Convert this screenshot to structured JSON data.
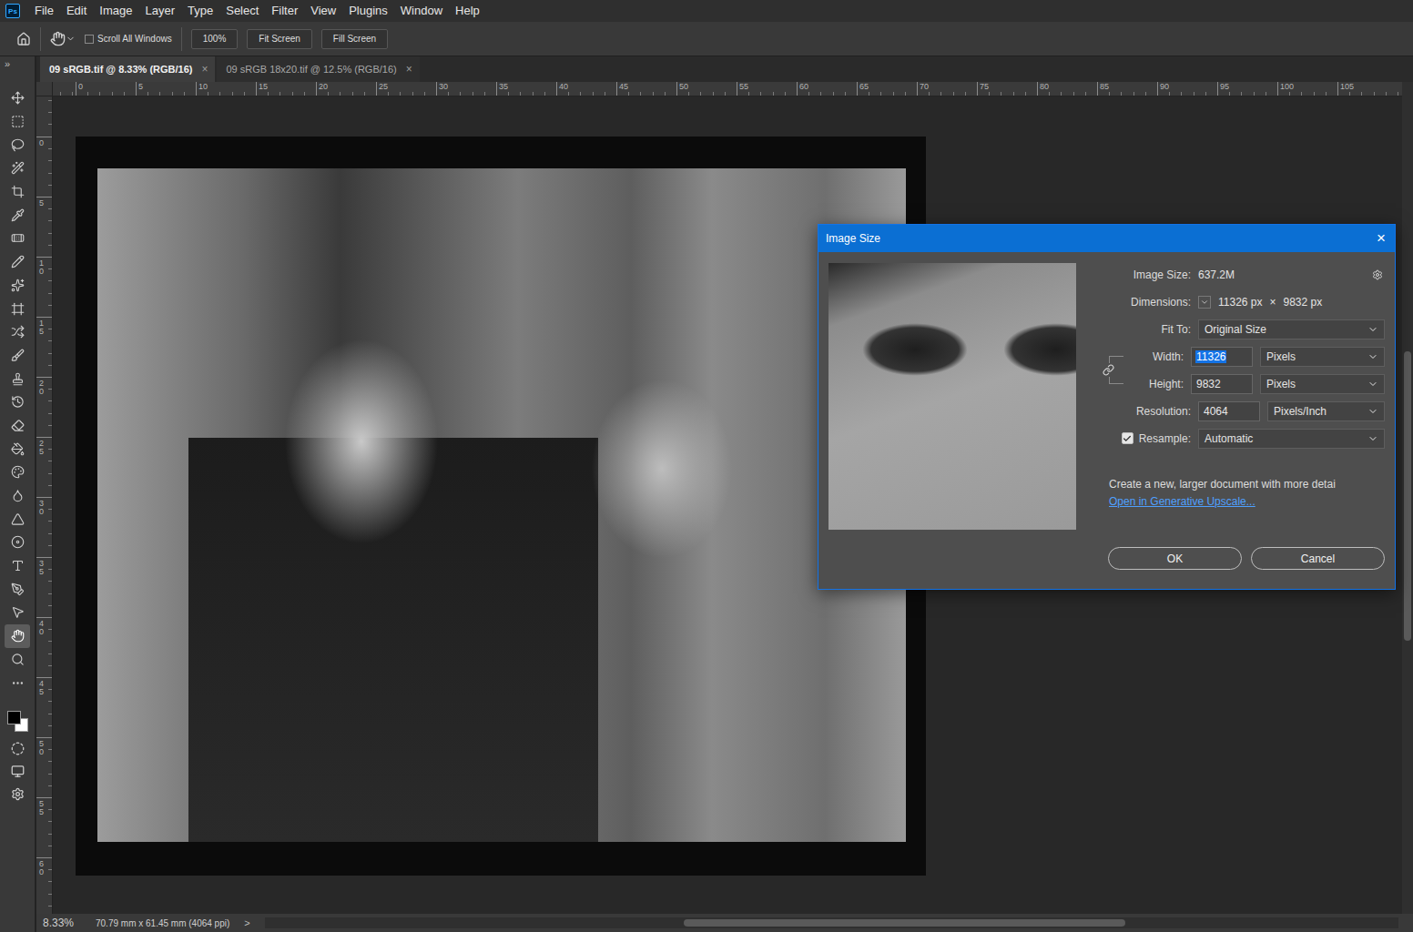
{
  "app": {
    "logo": "Ps"
  },
  "menu": [
    "File",
    "Edit",
    "Image",
    "Layer",
    "Type",
    "Select",
    "Filter",
    "View",
    "Plugins",
    "Window",
    "Help"
  ],
  "options_bar": {
    "scroll_all_windows": {
      "label": "Scroll All Windows",
      "checked": false
    },
    "buttons": [
      "100%",
      "Fit Screen",
      "Fill Screen"
    ]
  },
  "toolbar": {
    "collapse": "»",
    "tools": [
      {
        "kind": "move",
        "selected": false
      },
      {
        "kind": "marquee",
        "selected": false
      },
      {
        "kind": "lasso",
        "selected": false
      },
      {
        "kind": "wand",
        "selected": false
      },
      {
        "kind": "crop",
        "selected": false
      },
      {
        "kind": "eyedropper",
        "selected": false
      },
      {
        "kind": "healing",
        "selected": false
      },
      {
        "kind": "patch",
        "selected": false
      },
      {
        "kind": "spot",
        "selected": false
      },
      {
        "kind": "frame",
        "selected": false
      },
      {
        "kind": "content-move",
        "selected": false
      },
      {
        "kind": "brush",
        "selected": false
      },
      {
        "kind": "stamp",
        "selected": false
      },
      {
        "kind": "history-brush",
        "selected": false
      },
      {
        "kind": "eraser",
        "selected": false
      },
      {
        "kind": "fill",
        "selected": false
      },
      {
        "kind": "gradient",
        "selected": false
      },
      {
        "kind": "blur",
        "selected": false
      },
      {
        "kind": "sharpen",
        "selected": false
      },
      {
        "kind": "dodge",
        "selected": false
      },
      {
        "kind": "type",
        "selected": false
      },
      {
        "kind": "pen",
        "selected": false
      },
      {
        "kind": "path-select",
        "selected": false
      },
      {
        "kind": "hand",
        "selected": true
      },
      {
        "kind": "zoom",
        "selected": false
      },
      {
        "kind": "more",
        "selected": false
      }
    ],
    "swatches": [
      {
        "role": "foreground",
        "color": "#000000"
      },
      {
        "role": "background",
        "color": "#ffffff"
      }
    ]
  },
  "tabs": [
    {
      "label": "09 sRGB.tif @ 8.33% (RGB/16)",
      "close": "×",
      "selected": true
    },
    {
      "label": "09 sRGB 18x20.tif @ 12.5% (RGB/16)",
      "close": "×",
      "selected": false
    }
  ],
  "rulers": {
    "horizontal": [
      "0",
      "5",
      "10",
      "15",
      "20",
      "25",
      "30",
      "35",
      "40",
      "45",
      "50",
      "55",
      "60",
      "65",
      "70",
      "75",
      "80",
      "85",
      "90",
      "95",
      "100",
      "105"
    ],
    "vertical": [
      "0",
      "5",
      "10",
      "15",
      "20",
      "25",
      "30",
      "35",
      "40",
      "45",
      "50",
      "55",
      "60"
    ]
  },
  "dialog": {
    "title": "Image Size",
    "close": "×",
    "image_size": {
      "label": "Image Size:",
      "value": "637.2M"
    },
    "dimensions": {
      "label": "Dimensions:",
      "width": "11326 px",
      "times": "×",
      "height": "9832 px"
    },
    "fit_to": {
      "label": "Fit To:",
      "value": "Original Size"
    },
    "linked": true,
    "size_fields": [
      {
        "label": "Width:",
        "value": "11326",
        "unit": "Pixels",
        "selected": true
      },
      {
        "label": "Height:",
        "value": "9832",
        "unit": "Pixels",
        "selected": false
      }
    ],
    "resolution": {
      "label": "Resolution:",
      "value": "4064",
      "unit": "Pixels/Inch"
    },
    "resample": {
      "label": "Resample:",
      "checked": true,
      "value": "Automatic"
    },
    "note": "Create a new, larger document with more detai",
    "link": "Open in Generative Upscale...",
    "buttons": [
      "OK",
      "Cancel"
    ]
  },
  "status_bar": {
    "zoom": "8.33%",
    "info": "70.79 mm x 61.45 mm (4064 ppi)",
    "arrow": ">"
  }
}
